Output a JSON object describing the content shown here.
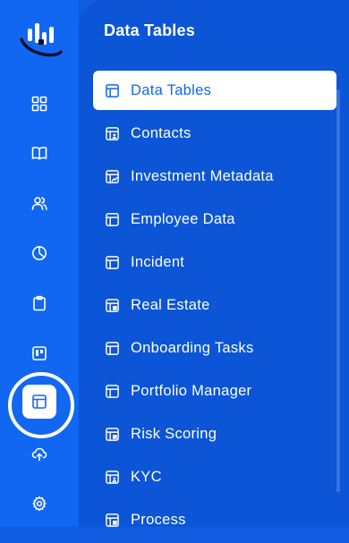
{
  "colors": {
    "accent": "#1565f0",
    "rail": "#1167f2",
    "panel": "#0b55d6"
  },
  "rail": {
    "items": [
      {
        "icon": "grid-icon"
      },
      {
        "icon": "book-icon"
      },
      {
        "icon": "users-icon"
      },
      {
        "icon": "pie-chart-icon"
      },
      {
        "icon": "clipboard-icon"
      },
      {
        "icon": "kanban-icon"
      },
      {
        "icon": "table-icon",
        "active": true
      },
      {
        "icon": "cloud-upload-icon"
      },
      {
        "icon": "settings-icon"
      }
    ]
  },
  "panel": {
    "title": "Data Tables",
    "items": [
      {
        "label": "Data Tables",
        "icon": "table-icon",
        "active": true
      },
      {
        "label": "Contacts",
        "icon": "table-person-icon"
      },
      {
        "label": "Investment Metadata",
        "icon": "table-chart-icon"
      },
      {
        "label": "Employee Data",
        "icon": "table-icon"
      },
      {
        "label": "Incident",
        "icon": "table-icon"
      },
      {
        "label": "Real Estate",
        "icon": "table-building-icon"
      },
      {
        "label": "Onboarding Tasks",
        "icon": "table-icon"
      },
      {
        "label": "Portfolio Manager",
        "icon": "table-icon"
      },
      {
        "label": "Risk Scoring",
        "icon": "table-building-icon"
      },
      {
        "label": "KYC",
        "icon": "table-person-icon"
      },
      {
        "label": "Process",
        "icon": "table-building-icon"
      }
    ]
  }
}
